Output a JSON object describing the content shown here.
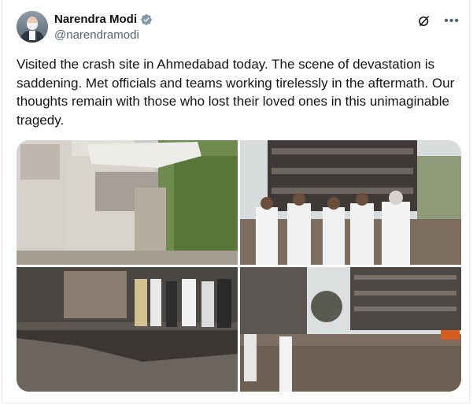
{
  "post": {
    "author": {
      "display_name": "Narendra Modi",
      "handle": "@narendramodi",
      "verified": true,
      "verified_badge_color": "#829aab"
    },
    "text": "Visited the crash site in Ahmedabad today. The scene of devastation is saddening. Met officials and teams working tirelessly in the aftermath. Our thoughts remain with those who lost their loved ones in this unimaginable tragedy.",
    "icons": {
      "grok": "grok-icon",
      "more": "more-options-icon"
    },
    "media": [
      {
        "kind": "photo",
        "subject": "damaged building with aircraft tail section"
      },
      {
        "kind": "photo",
        "subject": "officials at crash site"
      },
      {
        "kind": "photo",
        "subject": "officials walking through debris"
      },
      {
        "kind": "photo",
        "subject": "burnt building and debris"
      }
    ]
  },
  "colors": {
    "text_primary": "#0f1419",
    "text_secondary": "#536471",
    "border": "#e6e9eb"
  }
}
